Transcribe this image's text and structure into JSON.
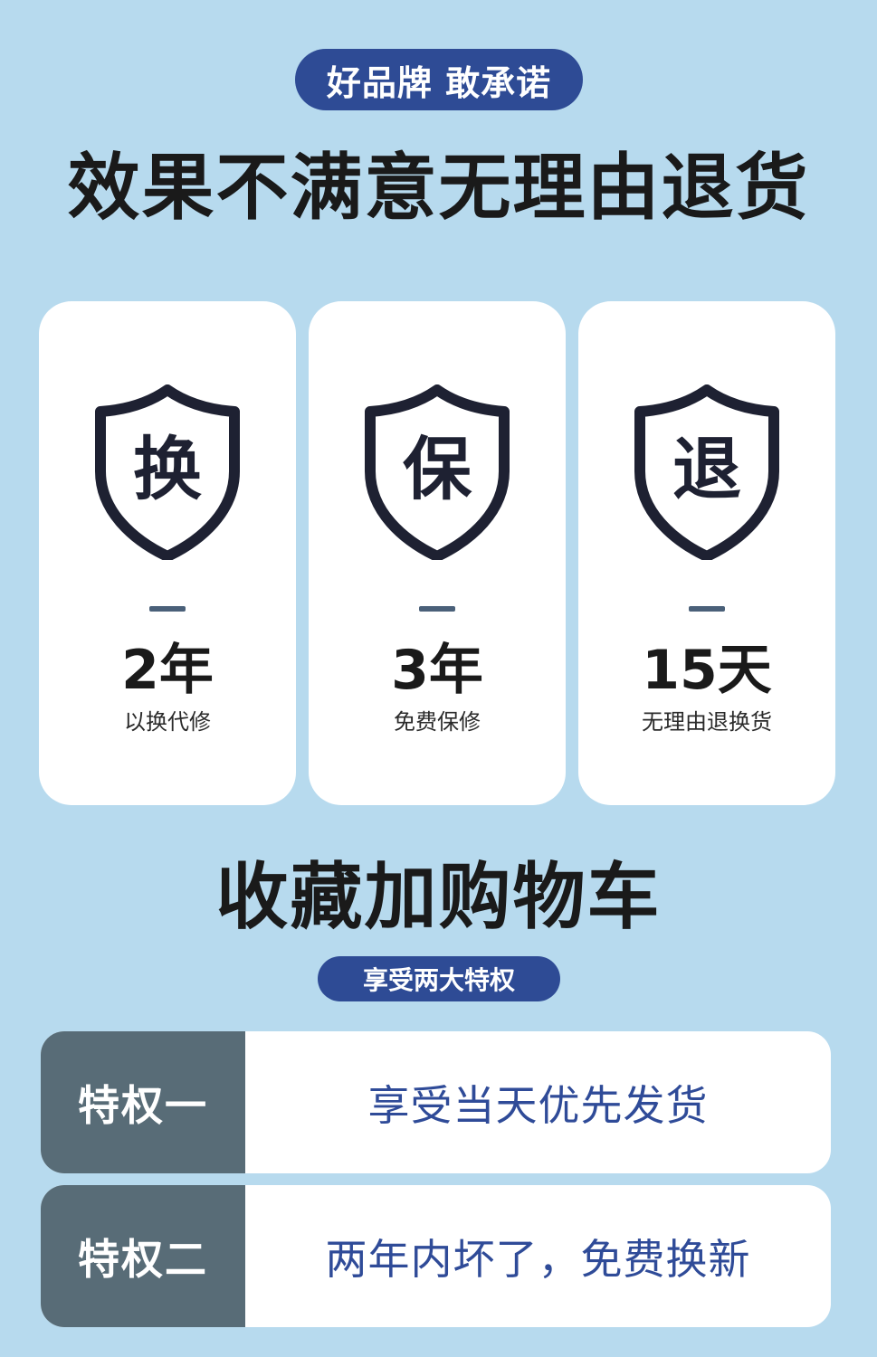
{
  "badge_top": "好品牌 敢承诺",
  "headline": "效果不满意无理由退货",
  "guarantees": [
    {
      "icon_char": "换",
      "big": "2年",
      "small": "以换代修"
    },
    {
      "icon_char": "保",
      "big": "3年",
      "small": "免费保修"
    },
    {
      "icon_char": "退",
      "big": "15天",
      "small": "无理由退换货"
    }
  ],
  "subhead": "收藏加购物车",
  "badge_small": "享受两大特权",
  "privileges": [
    {
      "label": "特权一",
      "text": "享受当天优先发货"
    },
    {
      "label": "特权二",
      "text": "两年内坏了，免费换新"
    }
  ],
  "colors": {
    "background": "#b7daee",
    "accent_blue": "#2e4b95",
    "shield_dark": "#1e2132",
    "privilege_label_bg": "#586c77",
    "privilege_text": "#2f4b98"
  },
  "icons": [
    "shield-icon",
    "shield-icon",
    "shield-icon"
  ]
}
